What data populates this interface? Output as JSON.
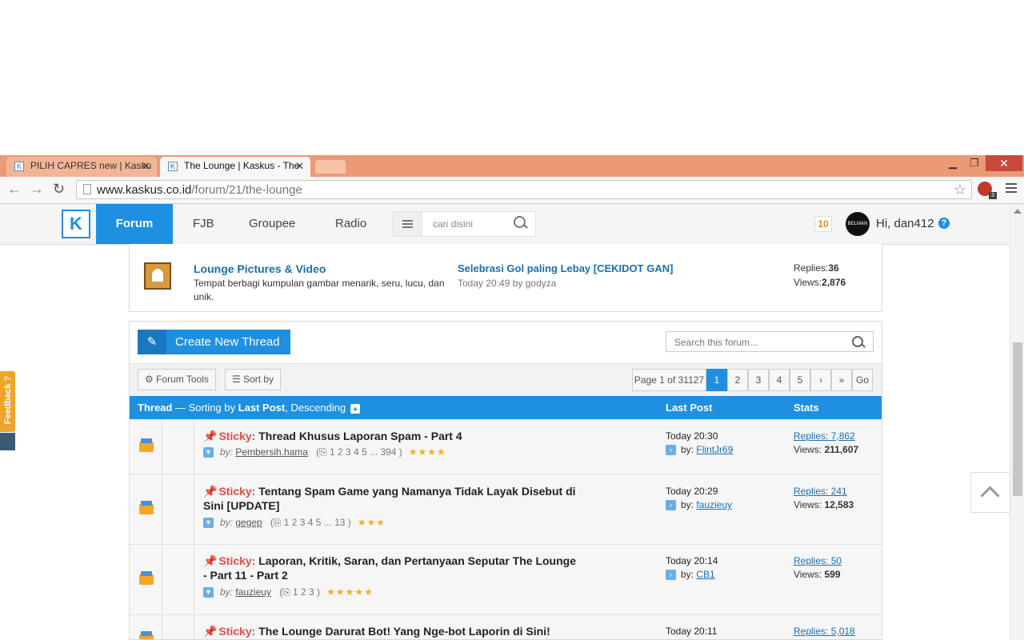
{
  "browser": {
    "tabs": [
      {
        "label": "PILIH CAPRES new | Kasku",
        "active": false
      },
      {
        "label": "The Lounge | Kaskus - The",
        "active": true
      }
    ],
    "url_host": "www.kaskus.co.id",
    "url_path": "/forum/21/the-lounge",
    "extension_badge": "3"
  },
  "site": {
    "logo": "K",
    "nav": [
      "Forum",
      "FJB",
      "Groupee",
      "Radio"
    ],
    "search_placeholder": "cari disini",
    "notifications": "10",
    "avatar_text": "BELMAN",
    "greeting": "Hi, dan412",
    "help": "?"
  },
  "feedback_label": "Feedback ?",
  "subforum": {
    "title": "Lounge Pictures & Video",
    "description": "Tempat berbagi kumpulan gambar menarik, seru, lucu, dan unik.",
    "last_thread": "Selebrasi Gol paling Lebay [CEKIDOT GAN]",
    "last_meta": "Today 20:49 by godyza",
    "replies_label": "Replies:",
    "replies": "36",
    "views_label": "Views:",
    "views": "2,876"
  },
  "toolbar": {
    "create_label": "Create New Thread",
    "search_placeholder": "Search this forum...",
    "forum_tools": "Forum Tools",
    "sort_by": "Sort by"
  },
  "pager": {
    "info": "Page 1 of 31127",
    "pages": [
      "1",
      "2",
      "3",
      "4",
      "5"
    ],
    "next": "›",
    "last": "»",
    "go": "Go"
  },
  "table_header": {
    "thread": "Thread",
    "sep": " — Sorting by ",
    "sort_field": "Last Post",
    "order": ", Descending",
    "last_post": "Last Post",
    "stats": "Stats"
  },
  "threads": [
    {
      "sticky": "Sticky:",
      "title": "Thread Khusus Laporan Spam - Part 4",
      "by": "by:",
      "author": "Pembersih.hama",
      "pages": "1  2  3  4  5 ... 394",
      "rating": 4,
      "last_time": "Today 20:30",
      "last_by": "by:",
      "last_user": "FlintJr69",
      "replies": "Replies: 7,862",
      "views_label": "Views:",
      "views": "211,607"
    },
    {
      "sticky": "Sticky:",
      "title": "Tentang Spam Game yang Namanya Tidak Layak Disebut di Sini [UPDATE]",
      "by": "by:",
      "author": "gegep",
      "pages": "1  2  3  4  5 ... 13",
      "rating": 3,
      "last_time": "Today 20:29",
      "last_by": "by:",
      "last_user": "fauzieuy",
      "replies": "Replies: 241",
      "views_label": "Views:",
      "views": "12,583"
    },
    {
      "sticky": "Sticky:",
      "title": "Laporan, Kritik, Saran, dan Pertanyaan Seputar The Lounge - Part 11 - Part 2",
      "by": "by:",
      "author": "fauzieuy",
      "pages": "1  2  3",
      "rating": 5,
      "last_time": "Today 20:14",
      "last_by": "by:",
      "last_user": "CB1",
      "replies": "Replies: 50",
      "views_label": "Views:",
      "views": "599"
    },
    {
      "sticky": "Sticky:",
      "title": "The Lounge Darurat Bot! Yang Nge-bot Laporin di Sini!",
      "last_time": "Today 20:11",
      "replies": "Replies: 5,018"
    }
  ]
}
